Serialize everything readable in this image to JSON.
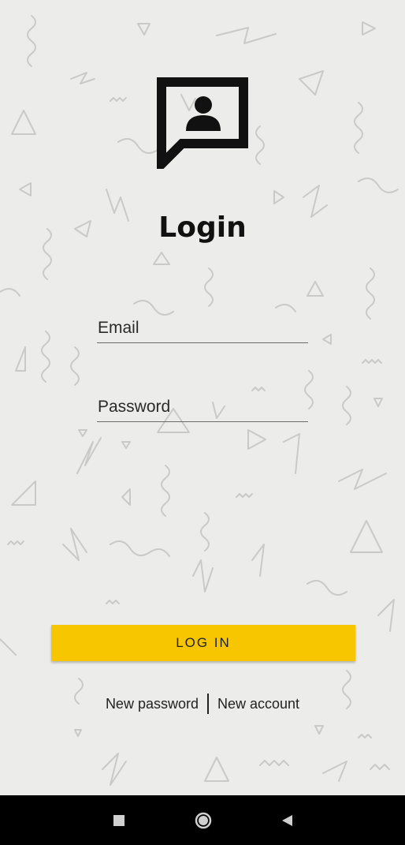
{
  "screen": {
    "title": "Login"
  },
  "form": {
    "email_placeholder": "Email",
    "password_placeholder": "Password"
  },
  "actions": {
    "login_label": "LOG IN",
    "new_password_label": "New password",
    "new_account_label": "New account"
  },
  "colors": {
    "background": "#ecedeb",
    "accent": "#f8c601",
    "text": "#111111"
  },
  "icons": {
    "logo": "contact-chat-bubble-icon",
    "nav_recents": "square-icon",
    "nav_home": "circle-icon",
    "nav_back": "triangle-back-icon"
  }
}
